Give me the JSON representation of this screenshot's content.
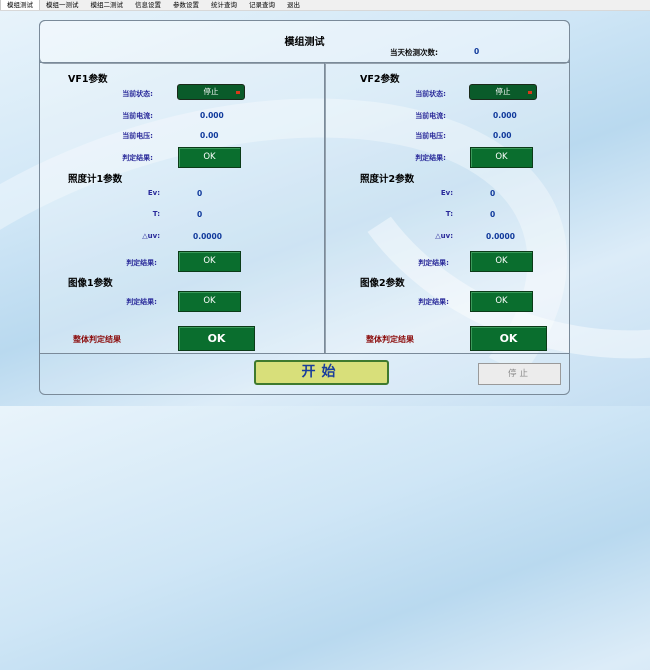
{
  "menu": [
    "模组测试",
    "模组一测试",
    "模组二测试",
    "信息设置",
    "参数设置",
    "统计查询",
    "记录查询",
    "退出"
  ],
  "title": "模组测试",
  "count": {
    "label": "当天检测次数:",
    "value": "0"
  },
  "left": {
    "vf_title": "VF1参数",
    "status_label": "当前状态:",
    "status_value": "停止",
    "current_label": "当前电流:",
    "current_value": "0.000",
    "voltage_label": "当前电压:",
    "voltage_value": "0.00",
    "vf_result_label": "判定结果:",
    "vf_result": "OK",
    "lux_title": "照度计1参数",
    "ev_label": "Ev:",
    "ev_value": "0",
    "t_label": "T:",
    "t_value": "0",
    "duv_label": "△uv:",
    "duv_value": "0.0000",
    "lux_result_label": "判定结果:",
    "lux_result": "OK",
    "img_title": "图像1参数",
    "img_result_label": "判定结果:",
    "img_result": "OK",
    "overall_label": "整体判定结果",
    "overall_result": "OK"
  },
  "right": {
    "vf_title": "VF2参数",
    "status_label": "当前状态:",
    "status_value": "停止",
    "current_label": "当前电流:",
    "current_value": "0.000",
    "voltage_label": "当前电压:",
    "voltage_value": "0.00",
    "vf_result_label": "判定结果:",
    "vf_result": "OK",
    "lux_title": "照度计2参数",
    "ev_label": "Ev:",
    "ev_value": "0",
    "t_label": "T:",
    "t_value": "0",
    "duv_label": "△uv:",
    "duv_value": "0.0000",
    "lux_result_label": "判定结果:",
    "lux_result": "OK",
    "img_title": "图像2参数",
    "img_result_label": "判定结果:",
    "img_result": "OK",
    "overall_label": "整体判定结果",
    "overall_result": "OK"
  },
  "buttons": {
    "start": "开始",
    "stop": "停止"
  },
  "colors": {
    "ok_bg": "#0a6e2e",
    "start_bg": "#d8df7a",
    "label_blue": "#2a2a9a",
    "overall_red": "#8b0b0b"
  }
}
